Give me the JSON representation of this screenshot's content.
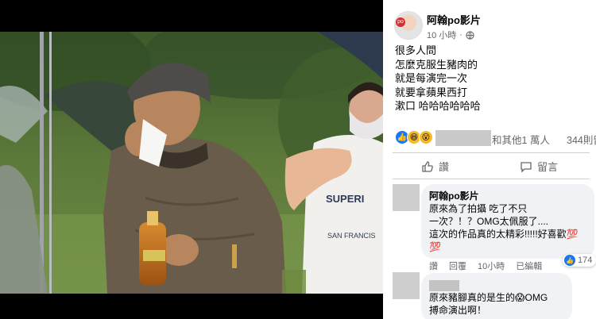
{
  "post": {
    "author": "阿翰po影片",
    "time": "10 小時",
    "time_sep": "·",
    "lines": [
      "很多人問",
      "怎麼克服生豬肉的",
      "就是每演完一次",
      "就要拿蘋果西打",
      "漱口 哈哈哈哈哈哈"
    ]
  },
  "reactions": {
    "icons": [
      "like-emoji",
      "haha-emoji",
      "wow-emoji"
    ],
    "others_text": "和其他1 萬人",
    "comments_text": "344則留"
  },
  "actions": {
    "like_label": "讚",
    "comment_label": "留言"
  },
  "comments": [
    {
      "author": "阿翰po影片",
      "lines": [
        "原來為了拍攝 吃了不只",
        "一次？！？OMG太佩服了....",
        "這次的作品真的太精彩!!!!!好喜歡💯"
      ],
      "trailing_emoji": "💯",
      "actions": [
        "讚",
        "回覆",
        "10小時",
        "已編輯"
      ],
      "likes": "174"
    },
    {
      "lines": [
        "原來豬腳真的是生的😱OMG",
        "搏命演出啊！"
      ]
    }
  ],
  "colors": {
    "accent": "#1877f2",
    "secondary_text": "#65676b",
    "bubble_bg": "#f0f2f5"
  }
}
